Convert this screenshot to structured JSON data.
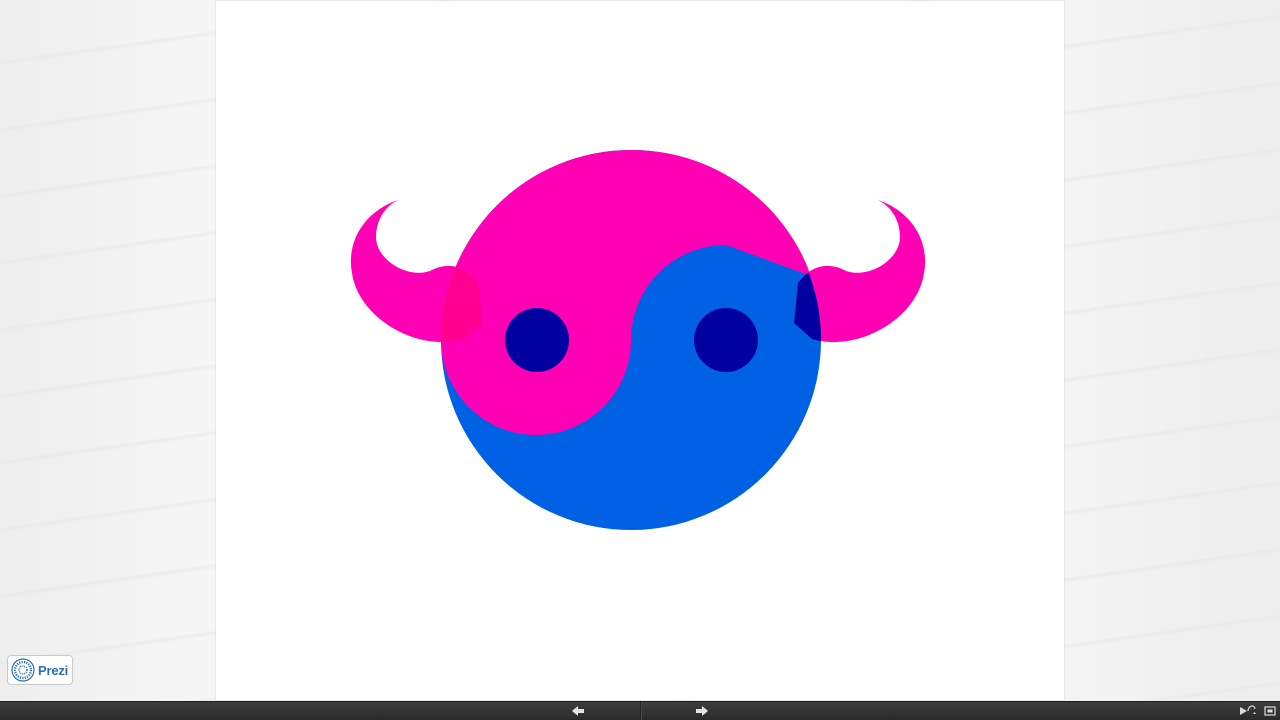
{
  "app": {
    "logo_text": "Prezi",
    "logo_icon": "prezi-logo-icon"
  },
  "slide": {
    "graphic": "yin-yang-bull-face",
    "colors": {
      "pink": "#ff00b4",
      "blue": "#0061e5",
      "eye": "#0000a0",
      "ear_overlap": "#ff0090",
      "background": "#ffffff"
    }
  },
  "toolbar": {
    "prev_icon": "arrow-left-icon",
    "next_icon": "arrow-right-icon",
    "autoplay_icon": "autoplay-icon",
    "fullscreen_icon": "fullscreen-icon",
    "background": "#333333"
  }
}
